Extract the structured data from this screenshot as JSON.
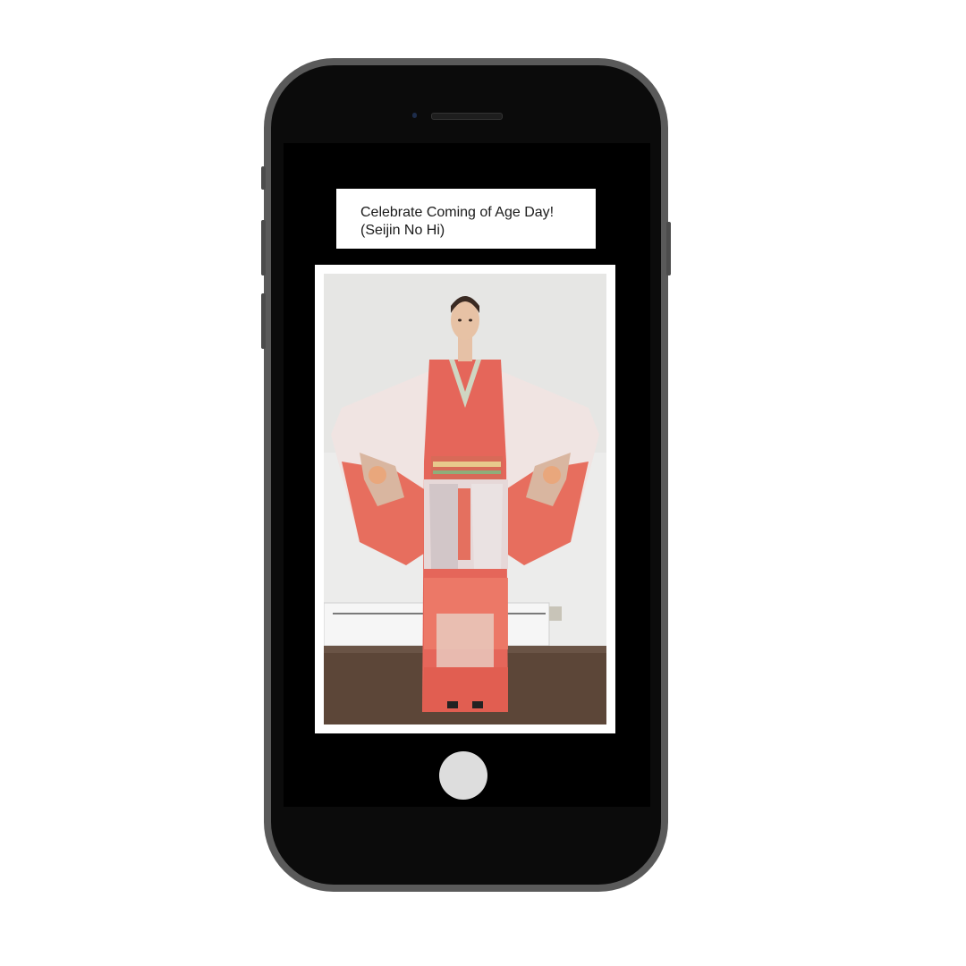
{
  "device": {
    "type": "smartphone",
    "home_button_icon": "circle-home-button"
  },
  "screen": {
    "banner": {
      "line1": "Celebrate Coming of Age Day!",
      "line2": "(Seijin No Hi)"
    },
    "photo": {
      "description_icon": "kimono-model-photo"
    }
  },
  "colors": {
    "phone_body": "#5a5a5a",
    "screen_bg": "#000000",
    "kimono_red": "#e5665a",
    "banner_bg": "#ffffff"
  }
}
